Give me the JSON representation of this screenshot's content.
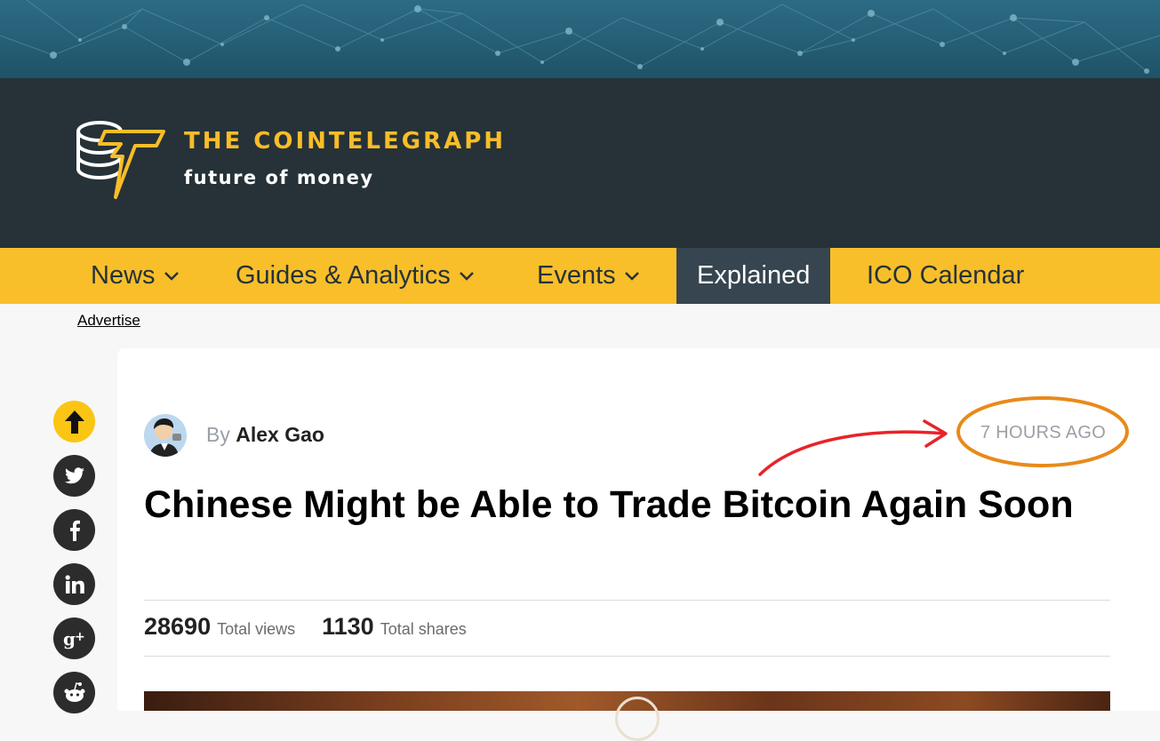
{
  "site": {
    "name": "THE COINTELEGRAPH",
    "tagline": "future of money"
  },
  "nav": {
    "items": [
      {
        "label": "News",
        "has_dropdown": true,
        "active": false
      },
      {
        "label": "Guides & Analytics",
        "has_dropdown": true,
        "active": false
      },
      {
        "label": "Events",
        "has_dropdown": true,
        "active": false
      },
      {
        "label": "Explained",
        "has_dropdown": false,
        "active": true
      },
      {
        "label": "ICO Calendar",
        "has_dropdown": false,
        "active": false
      }
    ]
  },
  "advertise": {
    "label": "Advertise"
  },
  "share": {
    "buttons": [
      "scroll-up-icon",
      "twitter-icon",
      "facebook-icon",
      "linkedin-icon",
      "google-plus-icon",
      "reddit-icon"
    ]
  },
  "article": {
    "byline_prefix": "By",
    "author": "Alex Gao",
    "timestamp": "7 HOURS AGO",
    "title": "Chinese Might be Able to Trade Bitcoin Again Soon",
    "stats": {
      "views": "28690",
      "views_label": "Total views",
      "shares": "1130",
      "shares_label": "Total shares"
    }
  },
  "colors": {
    "brand_yellow": "#f8bf2b",
    "header_dark": "#263238",
    "annotation_orange": "#e88a1a",
    "annotation_red": "#e8232a"
  }
}
